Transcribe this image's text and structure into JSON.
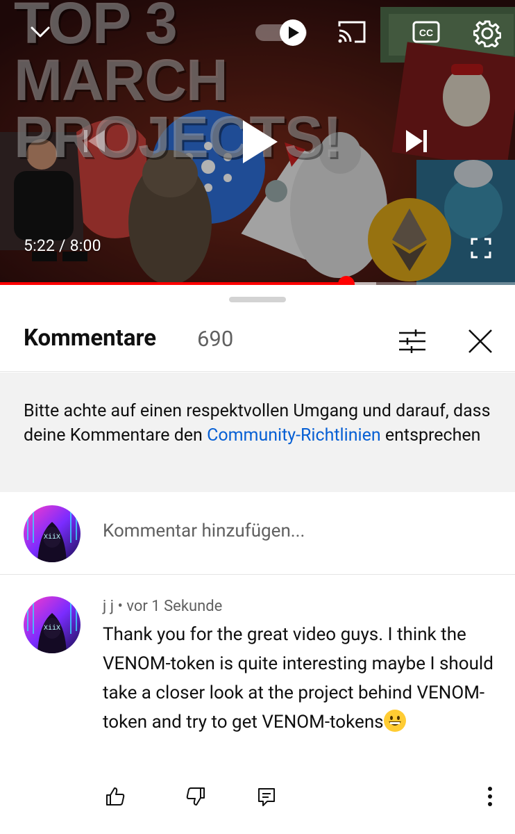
{
  "video": {
    "thumbnail_text": "TOP 3 MARCH PROJECTS!",
    "time_current": "5:22",
    "time_separator": " / ",
    "time_total": "8:00",
    "progress_fraction": 0.672,
    "buffer_fraction": 0.73,
    "icons": {
      "collapse": "chevron-down-icon",
      "autoplay": "autoplay-toggle-icon",
      "cast": "cast-icon",
      "captions": "closed-captions-icon",
      "settings": "gear-icon",
      "previous": "skip-previous-icon",
      "play": "play-icon",
      "next": "skip-next-icon",
      "fullscreen": "fullscreen-icon"
    },
    "accent_color": "#ff0000"
  },
  "comments": {
    "title": "Kommentare",
    "count": "690",
    "notice_part1": "Bitte achte auf einen respektvollen Umgang und darauf, dass deine Kommentare den ",
    "notice_link": "Community-Richtlinien",
    "notice_part2": " entsprechen",
    "add_placeholder": "Kommentar hinzufügen...",
    "items": [
      {
        "author": "j j",
        "separator": " • ",
        "time": "vor 1 Sekunde",
        "text": "Thank you for the great video guys. I think the VENOM-token is quite interesting maybe I should take a closer look at the project behind VENOM-token and try to get VENOM-tokens",
        "emoji": "grinning-face"
      }
    ],
    "link_color": "#065fd4"
  }
}
